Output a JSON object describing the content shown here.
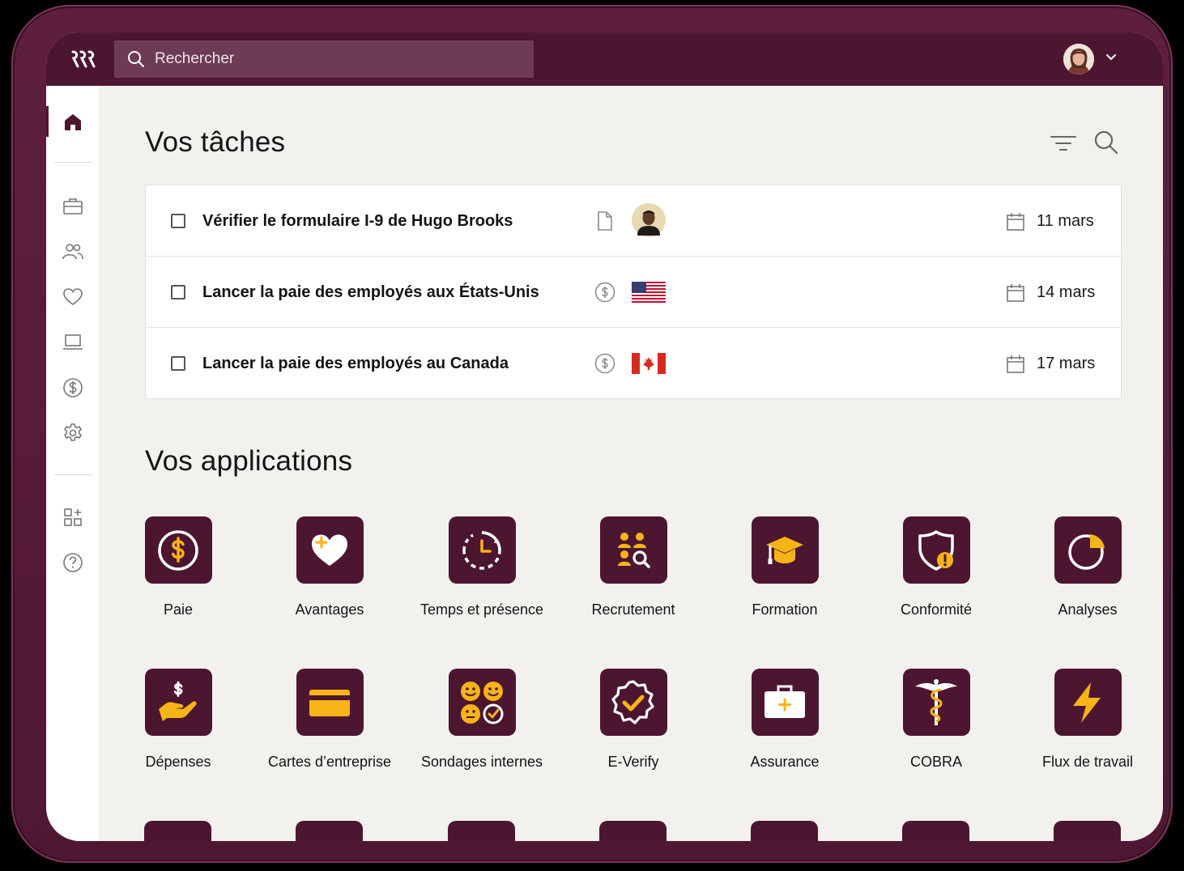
{
  "colors": {
    "brand": "#4d1630",
    "accent": "#f7b416",
    "background": "#f3f1ee"
  },
  "search": {
    "placeholder": "Rechercher"
  },
  "sidebar": {
    "items": [
      {
        "icon": "home-icon",
        "active": true
      },
      {
        "icon": "briefcase-icon"
      },
      {
        "icon": "people-icon"
      },
      {
        "icon": "heart-icon"
      },
      {
        "icon": "laptop-icon"
      },
      {
        "icon": "dollar-icon"
      },
      {
        "icon": "gear-icon"
      },
      {
        "icon": "apps-add-icon"
      },
      {
        "icon": "help-icon"
      }
    ]
  },
  "tasks": {
    "title": "Vos tâches",
    "items": [
      {
        "label": "Vérifier le formulaire I-9 de Hugo Brooks",
        "type_icon": "document-icon",
        "extra": "person-avatar",
        "date": "11 mars"
      },
      {
        "label": "Lancer la paie des employés aux États-Unis",
        "type_icon": "dollar-icon",
        "extra": "us-flag",
        "date": "14 mars"
      },
      {
        "label": "Lancer la paie des employés au Canada",
        "type_icon": "dollar-icon",
        "extra": "canada-flag",
        "date": "17 mars"
      }
    ]
  },
  "apps": {
    "title": "Vos applications",
    "items": [
      {
        "label": "Paie",
        "icon": "payroll-icon"
      },
      {
        "label": "Avantages",
        "icon": "benefits-heart-icon"
      },
      {
        "label": "Temps et présence",
        "icon": "time-clock-icon"
      },
      {
        "label": "Recrutement",
        "icon": "recruiting-icon"
      },
      {
        "label": "Formation",
        "icon": "graduation-cap-icon"
      },
      {
        "label": "Conformité",
        "icon": "compliance-shield-icon"
      },
      {
        "label": "Analyses",
        "icon": "analytics-pie-icon"
      },
      {
        "label": "Dépenses",
        "icon": "expenses-hand-icon"
      },
      {
        "label": "Cartes d’entreprise",
        "icon": "credit-card-icon"
      },
      {
        "label": "Sondages internes",
        "icon": "surveys-icon"
      },
      {
        "label": "E-Verify",
        "icon": "verified-badge-icon"
      },
      {
        "label": "Assurance",
        "icon": "insurance-case-icon"
      },
      {
        "label": "COBRA",
        "icon": "caduceus-icon"
      },
      {
        "label": "Flux de travail",
        "icon": "lightning-icon"
      }
    ]
  }
}
